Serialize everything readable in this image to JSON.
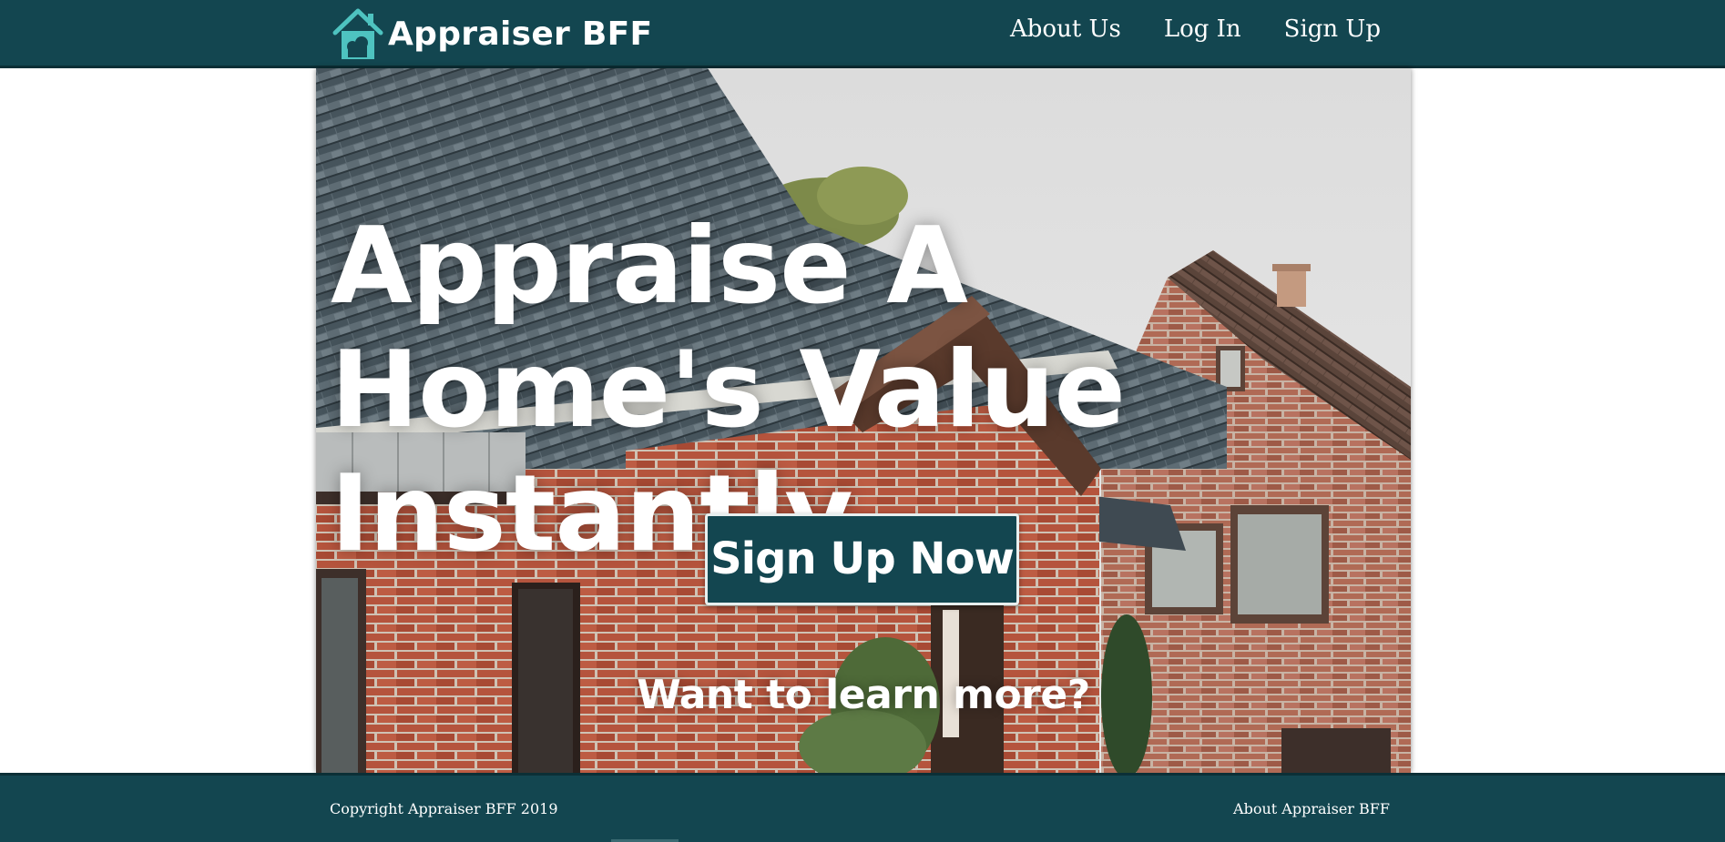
{
  "navbar": {
    "brand_name": "Appraiser BFF",
    "brand_icon": "house-logo-icon",
    "links": [
      {
        "label": "About Us"
      },
      {
        "label": "Log In"
      },
      {
        "label": "Sign Up"
      }
    ]
  },
  "hero": {
    "background": "photo-of-brick-houses-with-tiled-roofs",
    "headline": "Appraise A Home's Value Instantly",
    "cta_label": "Sign Up Now",
    "learn_more": "Want to learn more?"
  },
  "footer": {
    "copyright": "Copyright Appraiser BFF 2019",
    "about_link": "About Appraiser BFF"
  },
  "colors": {
    "primary": "#134650",
    "accent": "#4ec3c0",
    "text_light": "#ffffff"
  }
}
